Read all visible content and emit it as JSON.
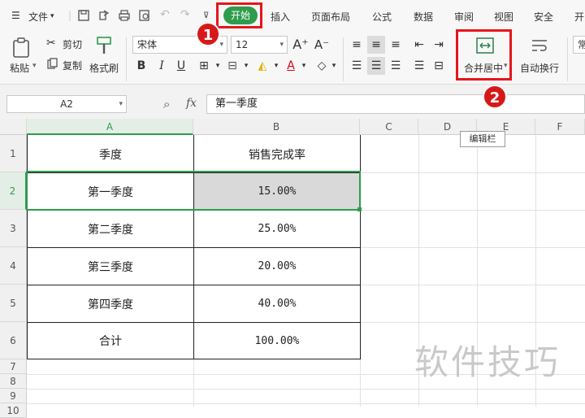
{
  "menu": {
    "file_label": "文件",
    "tabs": [
      "开始",
      "插入",
      "页面布局",
      "公式",
      "数据",
      "审阅",
      "视图",
      "安全",
      "开"
    ]
  },
  "ribbon": {
    "paste": "粘贴",
    "cut": "剪切",
    "copy": "复制",
    "format_painter": "格式刷",
    "font_name": "宋体",
    "font_size": "12",
    "merge_center": "合并居中",
    "wrap_text": "自动换行",
    "partial_right": "常"
  },
  "formula_bar": {
    "name_box": "A2",
    "fx": "fx",
    "content": "第一季度"
  },
  "tooltip": "编辑栏",
  "columns": [
    "A",
    "B",
    "C",
    "D",
    "E",
    "F"
  ],
  "rows": [
    "1",
    "2",
    "3",
    "4",
    "5",
    "6",
    "7",
    "8",
    "9",
    "10"
  ],
  "table": {
    "header": [
      "季度",
      "销售完成率"
    ],
    "rows": [
      [
        "第一季度",
        "15.00%"
      ],
      [
        "第二季度",
        "25.00%"
      ],
      [
        "第三季度",
        "20.00%"
      ],
      [
        "第四季度",
        "40.00%"
      ],
      [
        "合计",
        "100.00%"
      ]
    ]
  },
  "annotations": {
    "step1": "1",
    "step2": "2"
  },
  "watermark": "软件技巧",
  "colors": {
    "accent": "#2e9c4c",
    "highlight_red": "#e5161c",
    "selected_cell": "#d9d9d9"
  }
}
